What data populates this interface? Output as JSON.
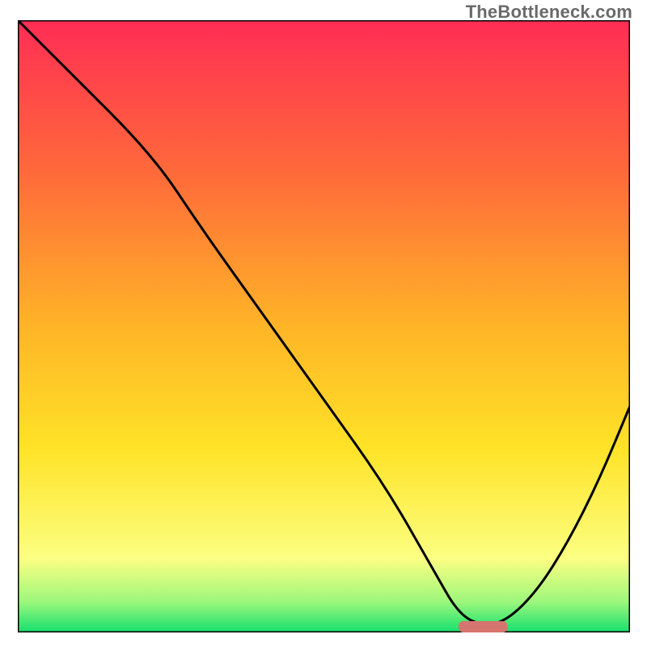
{
  "watermark": "TheBottleneck.com",
  "chart_data": {
    "type": "line",
    "title": "",
    "xlabel": "",
    "ylabel": "",
    "xlim": [
      0,
      100
    ],
    "ylim": [
      0,
      100
    ],
    "series": [
      {
        "name": "bottleneck-curve",
        "x": [
          0,
          8,
          22,
          30,
          40,
          50,
          60,
          68,
          72,
          76,
          80,
          85,
          90,
          95,
          100
        ],
        "y": [
          100,
          92,
          78,
          66,
          52,
          38,
          24,
          10,
          3,
          1,
          2,
          7,
          15,
          25,
          37
        ]
      }
    ],
    "marker": {
      "x_start": 72,
      "x_end": 80,
      "color": "#d6756f"
    },
    "gradient_stops": [
      {
        "offset": 0,
        "color": "#ff2d55"
      },
      {
        "offset": 25,
        "color": "#ff6a3a"
      },
      {
        "offset": 50,
        "color": "#ffb427"
      },
      {
        "offset": 70,
        "color": "#ffe327"
      },
      {
        "offset": 88,
        "color": "#fbff82"
      },
      {
        "offset": 95,
        "color": "#9cf77c"
      },
      {
        "offset": 100,
        "color": "#14e06e"
      }
    ]
  }
}
